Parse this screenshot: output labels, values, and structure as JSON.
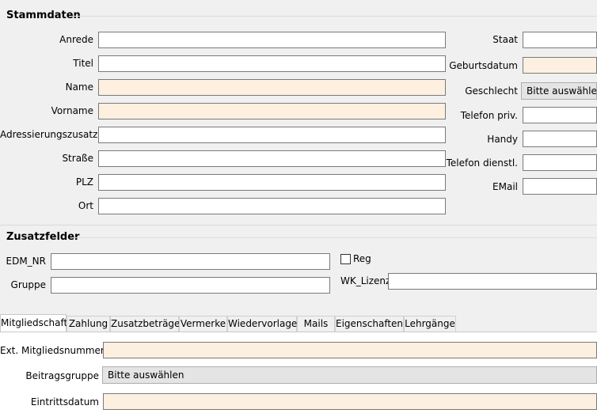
{
  "stammdaten": {
    "title": "Stammdaten",
    "anrede": {
      "label": "Anrede",
      "value": ""
    },
    "titel": {
      "label": "Titel",
      "value": ""
    },
    "name": {
      "label": "Name",
      "value": ""
    },
    "vorname": {
      "label": "Vorname",
      "value": ""
    },
    "adresszusatz": {
      "label": "Adressierungszusatz",
      "value": ""
    },
    "strasse": {
      "label": "Straße",
      "value": ""
    },
    "plz": {
      "label": "PLZ",
      "value": ""
    },
    "ort": {
      "label": "Ort",
      "value": ""
    },
    "staat": {
      "label": "Staat",
      "value": ""
    },
    "geburtsdatum": {
      "label": "Geburtsdatum",
      "value": ""
    },
    "geschlecht": {
      "label": "Geschlecht",
      "selected": "Bitte auswählen"
    },
    "telefon_priv": {
      "label": "Telefon priv.",
      "value": ""
    },
    "handy": {
      "label": "Handy",
      "value": ""
    },
    "telefon_dienstl": {
      "label": "Telefon dienstl.",
      "value": ""
    },
    "email": {
      "label": "EMail",
      "value": ""
    }
  },
  "zusatzfelder": {
    "title": "Zusatzfelder",
    "edm_nr": {
      "label": "EDM_NR",
      "value": ""
    },
    "gruppe": {
      "label": "Gruppe",
      "value": ""
    },
    "reg": {
      "label": "Reg",
      "checked": false
    },
    "wk_lizenz": {
      "label": "WK_Lizenz",
      "value": ""
    }
  },
  "tabs": [
    {
      "label": "Mitgliedschaft",
      "active": true
    },
    {
      "label": "Zahlung",
      "active": false
    },
    {
      "label": "Zusatzbeträge",
      "active": false
    },
    {
      "label": "Vermerke",
      "active": false
    },
    {
      "label": "Wiedervorlage",
      "active": false
    },
    {
      "label": "Mails",
      "active": false
    },
    {
      "label": "Eigenschaften",
      "active": false
    },
    {
      "label": "Lehrgänge",
      "active": false
    }
  ],
  "mitgliedschaft": {
    "ext_mitgliedsnummer": {
      "label": "Ext. Mitgliedsnummer",
      "value": ""
    },
    "beitragsgruppe": {
      "label": "Beitragsgruppe",
      "selected": "Bitte auswählen"
    },
    "eintrittsdatum": {
      "label": "Eintrittsdatum",
      "value": ""
    }
  },
  "colors": {
    "required_field_bg": "#fdf0e0",
    "window_bg": "#f0f0f0",
    "combo_bg": "#e4e4e4"
  }
}
